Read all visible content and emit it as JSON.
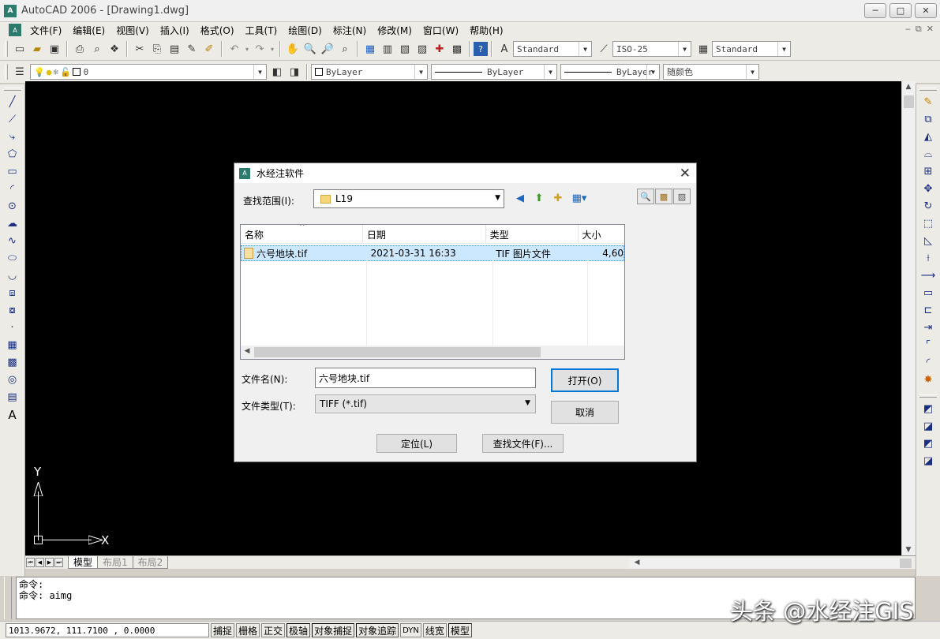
{
  "window": {
    "title": "AutoCAD 2006 - [Drawing1.dwg]",
    "logo_text": "A",
    "min_label": "─",
    "max_label": "□",
    "close_label": "✕"
  },
  "menu": [
    "文件(F)",
    "编辑(E)",
    "视图(V)",
    "插入(I)",
    "格式(O)",
    "工具(T)",
    "绘图(D)",
    "标注(N)",
    "修改(M)",
    "窗口(W)",
    "帮助(H)"
  ],
  "toolbar": {
    "text_style": "Standard",
    "dim_style": "ISO-25",
    "table_style": "Standard",
    "layer": "0",
    "color": "ByLayer",
    "linetype": "ByLayer",
    "lineweight": "ByLayer",
    "plotstyle": "随颜色"
  },
  "ucs": {
    "y": "Y",
    "x": "X"
  },
  "tabs": {
    "model": "模型",
    "layout1": "布局1",
    "layout2": "布局2"
  },
  "command": {
    "line1": "命令:",
    "line2": "命令: aimg"
  },
  "status": {
    "coords": "1013.9672, 111.7100 , 0.0000",
    "buttons": [
      "捕捉",
      "栅格",
      "正交",
      "极轴",
      "对象捕捉",
      "对象追踪",
      "DYN",
      "线宽",
      "模型"
    ]
  },
  "watermark": "头条 @水经注GIS",
  "dialog": {
    "title": "水经注软件",
    "close_label": "✕",
    "lookin_label": "查找范围(I):",
    "lookin_value": "L19",
    "columns": [
      "名称",
      "日期",
      "类型",
      "大小"
    ],
    "files": [
      {
        "name": "六号地块.tif",
        "date": "2021-03-31 16:33",
        "type": "TIF 图片文件",
        "size": "4,60"
      }
    ],
    "filename_label": "文件名(N):",
    "filename_value": "六号地块.tif",
    "filetype_label": "文件类型(T):",
    "filetype_value": "TIFF (*.tif)",
    "open_button": "打开(O)",
    "cancel_button": "取消",
    "locate_button": "定位(L)",
    "find_button": "查找文件(F)..."
  }
}
